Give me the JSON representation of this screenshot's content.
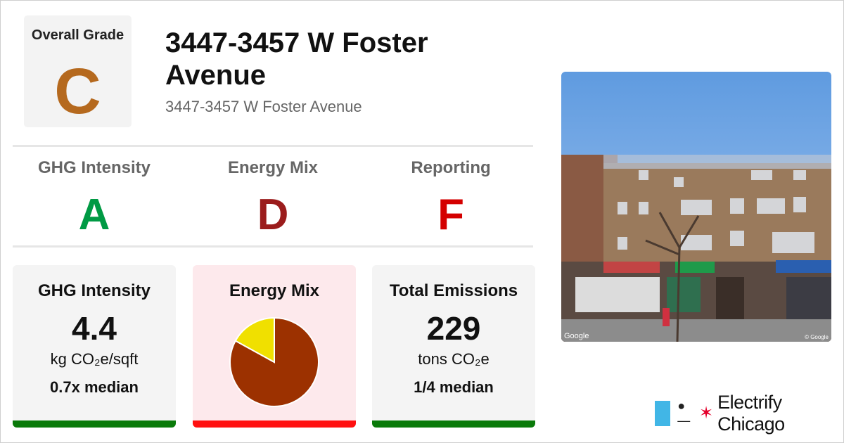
{
  "overall": {
    "label": "Overall Grade",
    "grade": "C",
    "grade_color": "#b5691e"
  },
  "building": {
    "title": "3447-3457 W Foster Avenue",
    "address": "3447-3457 W Foster Avenue"
  },
  "grades": [
    {
      "name": "GHG Intensity",
      "grade": "A",
      "color": "#009a44"
    },
    {
      "name": "Energy Mix",
      "grade": "D",
      "color": "#9b1c1c"
    },
    {
      "name": "Reporting",
      "grade": "F",
      "color": "#d40000"
    }
  ],
  "cards": {
    "ghg": {
      "title": "GHG Intensity",
      "value": "4.4",
      "unit": "kg CO₂e/sqft",
      "comparison": "0.7x median",
      "bar_color": "#0a7a0a"
    },
    "mix": {
      "title": "Energy Mix",
      "bar_color": "#ff1010"
    },
    "emissions": {
      "title": "Total Emissions",
      "value": "229",
      "unit": "tons CO₂e",
      "comparison": "1/4 median",
      "bar_color": "#0a7a0a"
    }
  },
  "chart_data": {
    "type": "pie",
    "title": "Energy Mix",
    "series": [
      {
        "values": [
          0.83,
          0.17
        ]
      }
    ],
    "colors": [
      "#9c3100",
      "#f0e000"
    ]
  },
  "photo": {
    "credit_left": "Google",
    "credit_right": "© Google"
  },
  "brand": {
    "name": "Electrify Chicago",
    "flag_color": "#41b6e6",
    "star_color": "#e4002b"
  }
}
